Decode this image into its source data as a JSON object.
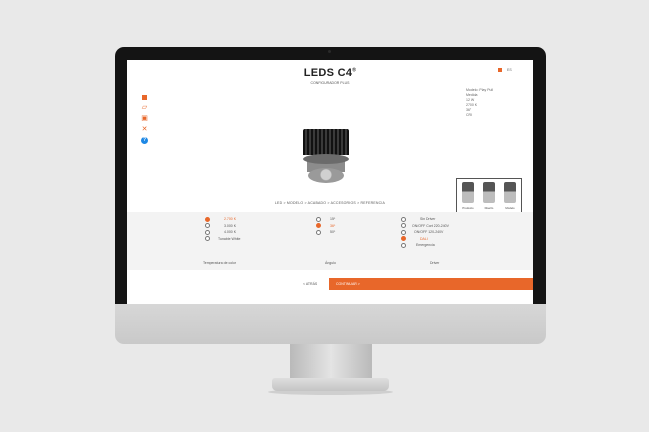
{
  "brand": {
    "title": "LEDS C4",
    "trademark": "®",
    "subtitle": "CONFIGURADOR PLUS"
  },
  "header": {
    "language": "ES"
  },
  "specs": [
    "Modelo: Play Pull",
    "Medida",
    "12 W",
    "2700 K",
    "36°",
    "CRI"
  ],
  "toolbar": [
    "square-icon",
    "folder-icon",
    "box-icon",
    "close-icon",
    "help-icon"
  ],
  "breadcrumb": "LED  >  MODELO  >  ACABADO  >  ACCESORIOS  >  REFERENCIA",
  "views": [
    "Producto",
    "Diseño",
    "Modelo"
  ],
  "options": {
    "temperature": {
      "label": "Temperatura de color",
      "items": [
        {
          "text": "2.700 K",
          "selected": true
        },
        {
          "text": "3.000 K",
          "selected": false
        },
        {
          "text": "4.000 K",
          "selected": false
        },
        {
          "text": "Tunable White",
          "selected": false
        }
      ]
    },
    "angle": {
      "label": "Ángulo",
      "items": [
        {
          "text": "15º",
          "selected": false
        },
        {
          "text": "36º",
          "selected": true
        },
        {
          "text": "50º",
          "selected": false
        }
      ]
    },
    "driver": {
      "label": "Driver",
      "items": [
        {
          "text": "Sin Driver",
          "selected": false
        },
        {
          "text": "ON/OFF Cort 220-240V",
          "selected": false
        },
        {
          "text": "ON/OFF 120-240V",
          "selected": false
        },
        {
          "text": "DALI",
          "selected": true
        },
        {
          "text": "Emergencia",
          "selected": false
        }
      ]
    }
  },
  "footer": {
    "back": "< ATRÁS",
    "continue": "CONTINUAR  >"
  },
  "colors": {
    "accent": "#e8672a",
    "help": "#1e88e5"
  }
}
